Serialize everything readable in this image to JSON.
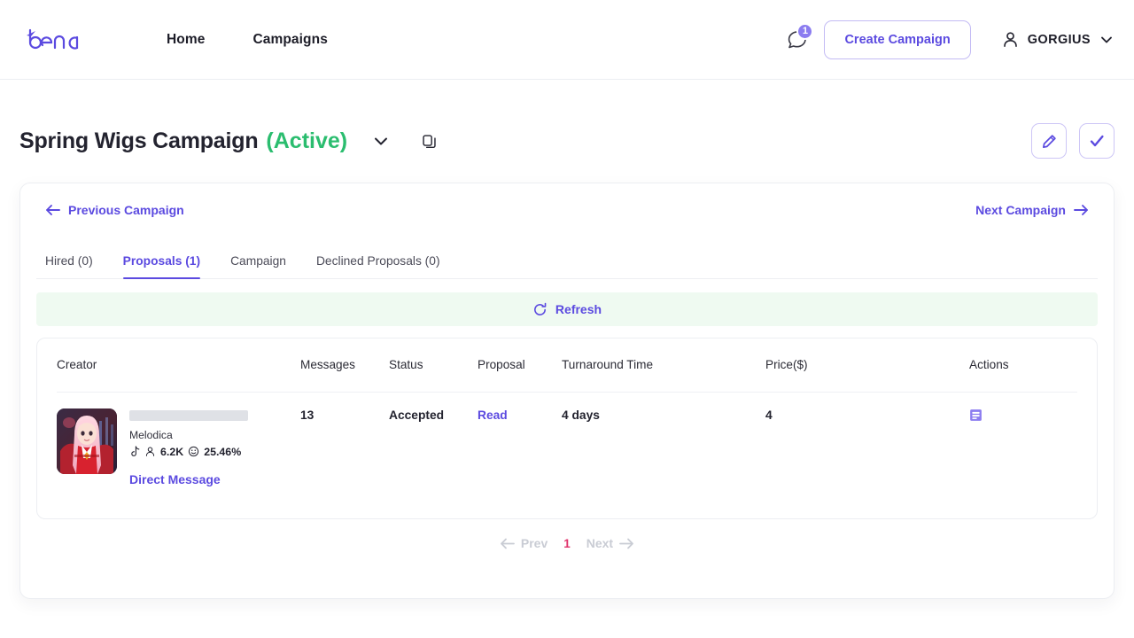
{
  "header": {
    "logo_text": "bena",
    "nav": [
      {
        "label": "Home"
      },
      {
        "label": "Campaigns"
      }
    ],
    "notification_count": "1",
    "create_campaign_label": "Create Campaign",
    "user_name": "GORGIUS"
  },
  "title_bar": {
    "campaign_name": "Spring Wigs Campaign",
    "status": "(Active)",
    "status_color": "#2bbd6f"
  },
  "campaign_nav": {
    "previous_label": "Previous Campaign",
    "next_label": "Next Campaign"
  },
  "tabs": [
    {
      "label": "Hired (0)",
      "active": false
    },
    {
      "label": "Proposals (1)",
      "active": true
    },
    {
      "label": "Campaign",
      "active": false
    },
    {
      "label": "Declined Proposals (0)",
      "active": false
    }
  ],
  "refresh": {
    "label": "Refresh",
    "background": "#effaf1"
  },
  "table": {
    "columns": [
      "Creator",
      "Messages",
      "Status",
      "Proposal",
      "Turnaround Time",
      "Price($)",
      "Actions"
    ],
    "rows": [
      {
        "creator_name": "Melodica",
        "followers": "6.2K",
        "engagement": "25.46%",
        "direct_message_label": "Direct Message",
        "messages": "13",
        "status": "Accepted",
        "proposal": "Read",
        "turnaround_time": "4 days",
        "price": "4"
      }
    ]
  },
  "pagination": {
    "prev_label": "Prev",
    "next_label": "Next",
    "current_page": "1",
    "current_page_color": "#e0336b"
  },
  "theme": {
    "accent": "#5b4ae0",
    "accent_light": "#8b7cf0"
  }
}
